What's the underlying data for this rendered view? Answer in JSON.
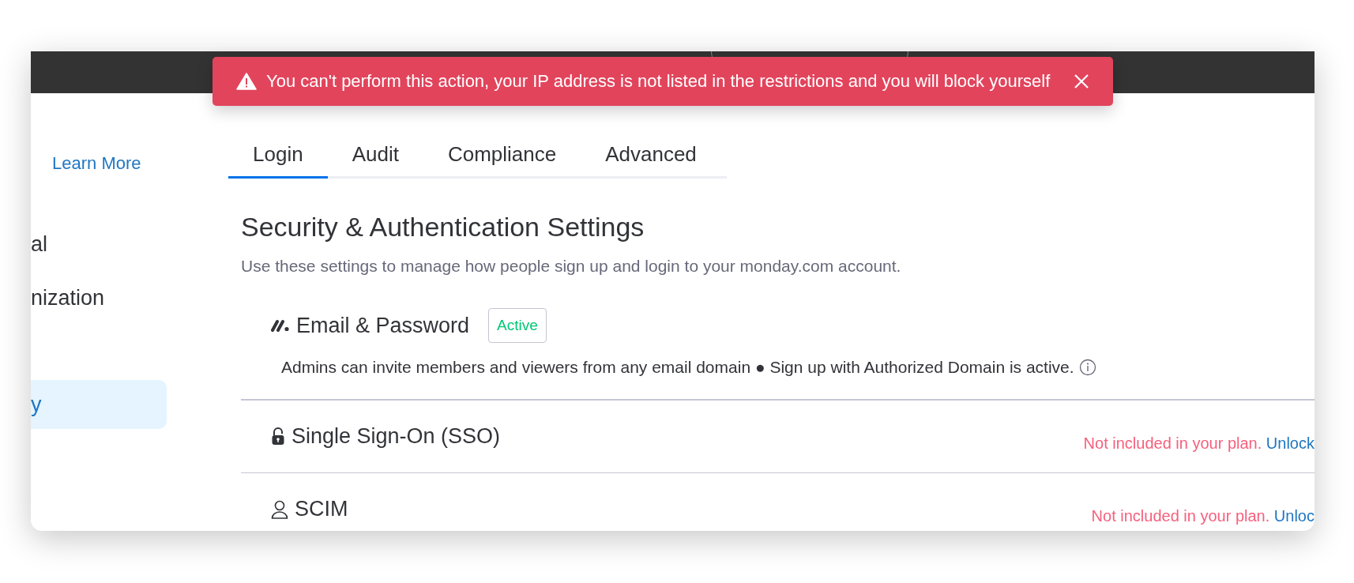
{
  "toast": {
    "message": "You can't perform this action, your IP address is not listed in the restrictions and you will block yourself"
  },
  "sidebar": {
    "link": "Learn More",
    "items": [
      {
        "label": "al",
        "selected": false
      },
      {
        "label": "nization",
        "selected": false
      },
      {
        "label": "y",
        "selected": true
      }
    ]
  },
  "tabs": [
    {
      "label": "Login",
      "selected": true
    },
    {
      "label": "Audit",
      "selected": false
    },
    {
      "label": "Compliance",
      "selected": false
    },
    {
      "label": "Advanced",
      "selected": false
    }
  ],
  "heading": "Security & Authentication Settings",
  "subtitle": "Use these settings to manage how people sign up and login to your monday.com account.",
  "methods": [
    {
      "kind": "email",
      "title": "Email & Password",
      "badge": "Active",
      "description": "Admins can invite members and viewers from any email domain ● Sign up with Authorized Domain is active."
    },
    {
      "kind": "sso",
      "title": "Single Sign-On (SSO)",
      "status": "Not included in your plan.",
      "link": "Unlock"
    },
    {
      "kind": "scim",
      "title": "SCIM",
      "status": "Not included in your plan.",
      "link": "Unloc"
    }
  ]
}
